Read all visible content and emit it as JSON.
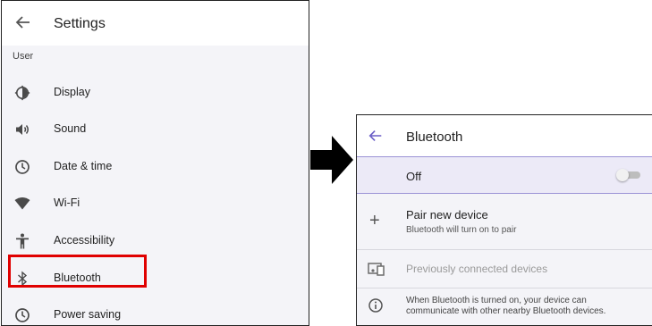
{
  "settings": {
    "title": "Settings",
    "section": "User",
    "items": [
      {
        "label": "Display",
        "icon": "display-brightness-icon"
      },
      {
        "label": "Sound",
        "icon": "speaker-icon"
      },
      {
        "label": "Date & time",
        "icon": "clock-icon"
      },
      {
        "label": "Wi-Fi",
        "icon": "wifi-icon"
      },
      {
        "label": "Accessibility",
        "icon": "accessibility-icon"
      },
      {
        "label": "Bluetooth",
        "icon": "bluetooth-icon"
      },
      {
        "label": "Power saving",
        "icon": "clock-icon"
      }
    ]
  },
  "bluetooth": {
    "title": "Bluetooth",
    "toggle_label": "Off",
    "pair_title": "Pair new device",
    "pair_subtitle": "Bluetooth will turn on to pair",
    "previous_label": "Previously connected devices",
    "info_text": "When Bluetooth is turned on, your device can\ncommunicate with other nearby Bluetooth devices."
  },
  "colors": {
    "highlight": "#e00000",
    "accent": "#6b5fc7",
    "toggle_row": "#eceaf7"
  }
}
